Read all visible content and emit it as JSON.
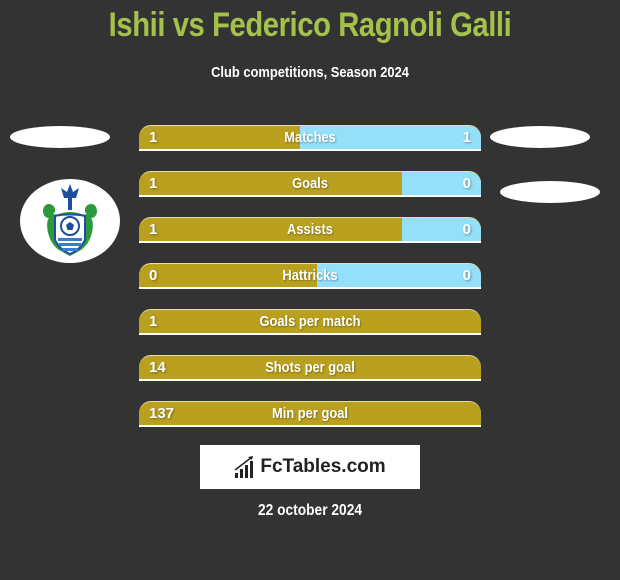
{
  "header": {
    "title": "Ishii vs Federico Ragnoli Galli",
    "subtitle": "Club competitions, Season 2024"
  },
  "colors": {
    "background": "#333333",
    "title": "#a4c24b",
    "left_bar": "#b9a11f",
    "right_bar": "#93e0f8"
  },
  "left_team": {
    "badge_icon": "shonan-bellmare-crest-icon"
  },
  "stats": [
    {
      "label": "Matches",
      "left": "1",
      "right": "1",
      "right_share": 0.53
    },
    {
      "label": "Goals",
      "left": "1",
      "right": "0",
      "right_share": 0.23
    },
    {
      "label": "Assists",
      "left": "1",
      "right": "0",
      "right_share": 0.23
    },
    {
      "label": "Hattricks",
      "left": "0",
      "right": "0",
      "right_share": 0.48
    },
    {
      "label": "Goals per match",
      "left": "1",
      "right": "",
      "right_share": 0
    },
    {
      "label": "Shots per goal",
      "left": "14",
      "right": "",
      "right_share": 0
    },
    {
      "label": "Min per goal",
      "left": "137",
      "right": "",
      "right_share": 0
    }
  ],
  "footer": {
    "brand": "FcTables.com",
    "brand_icon": "bar-chart-icon",
    "date": "22 october 2024"
  }
}
